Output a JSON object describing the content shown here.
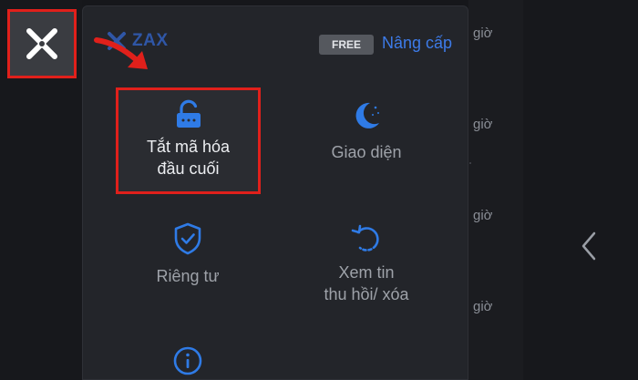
{
  "app": {
    "brand": "ZAX",
    "plan_badge": "FREE",
    "upgrade_link": "Nâng cấp"
  },
  "menu": {
    "items": [
      {
        "label_line1": "Tắt mã hóa",
        "label_line2": "đầu cuối",
        "icon": "unlock-icon"
      },
      {
        "label_line1": "Giao diện",
        "label_line2": "",
        "icon": "moon-icon"
      },
      {
        "label_line1": "Riêng tư",
        "label_line2": "",
        "icon": "shield-check-icon"
      },
      {
        "label_line1": "Xem tin",
        "label_line2": "thu hồi/ xóa",
        "icon": "restore-icon"
      },
      {
        "label_line1": "",
        "label_line2": "",
        "icon": "info-icon"
      }
    ]
  },
  "background_list": {
    "times": [
      "giờ",
      "giờ",
      "giờ",
      "giờ"
    ]
  },
  "colors": {
    "brand": "#2f56a6",
    "accent": "#3d7be8",
    "highlight": "#e0201b",
    "icon_blue": "#2f7be6"
  }
}
